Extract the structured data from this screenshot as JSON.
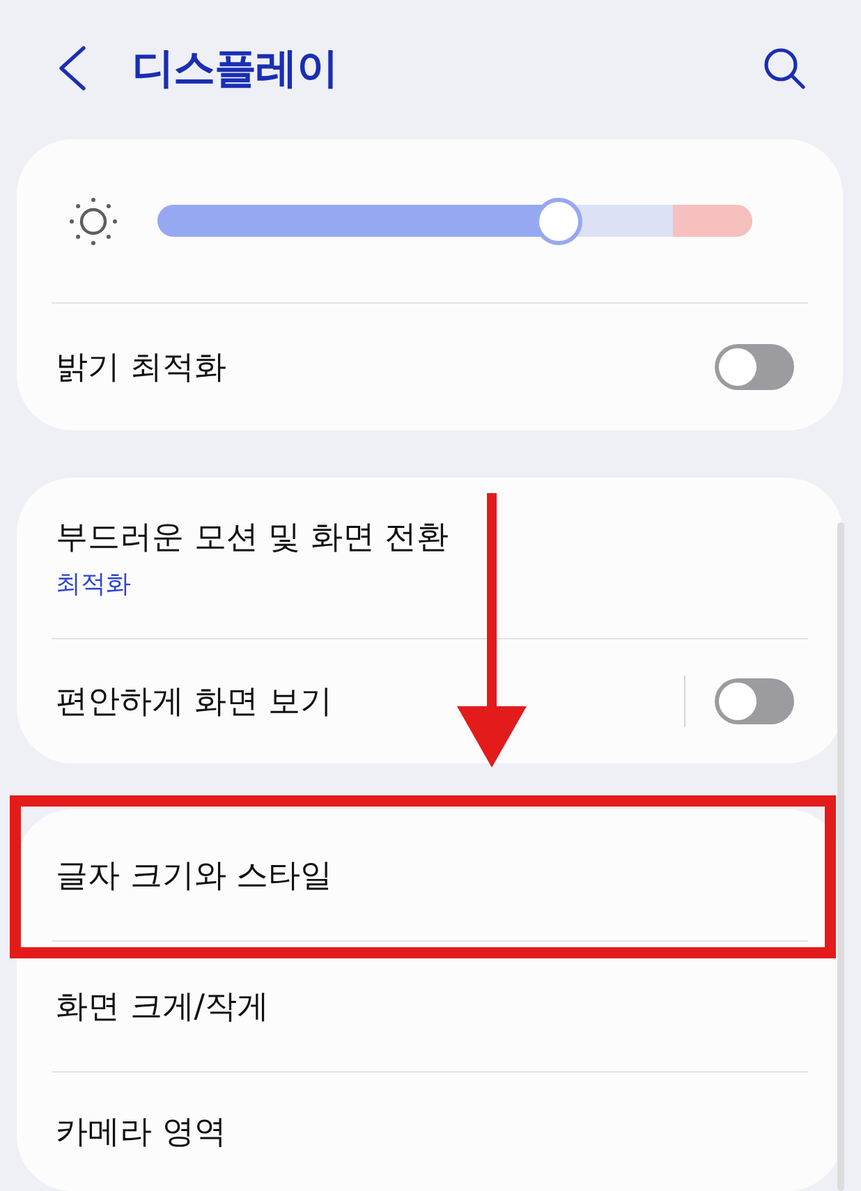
{
  "header": {
    "title": "디스플레이"
  },
  "cards": [
    {
      "items": [
        {
          "kind": "slider",
          "level": 0.674
        },
        {
          "kind": "switch",
          "label": "밝기 최적화",
          "on": false
        }
      ]
    },
    {
      "items": [
        {
          "kind": "link",
          "label": "부드러운 모션 및 화면 전환",
          "subtitle": "최적화",
          "highlighted": false
        },
        {
          "kind": "split-switch",
          "label": "편안하게 화면 보기",
          "on": false
        }
      ]
    },
    {
      "items": [
        {
          "kind": "link",
          "label": "글자 크기와 스타일",
          "highlighted": true
        },
        {
          "kind": "link",
          "label": "화면 크게/작게",
          "highlighted": false
        },
        {
          "kind": "link",
          "label": "카메라 영역",
          "highlighted": false
        }
      ]
    }
  ]
}
